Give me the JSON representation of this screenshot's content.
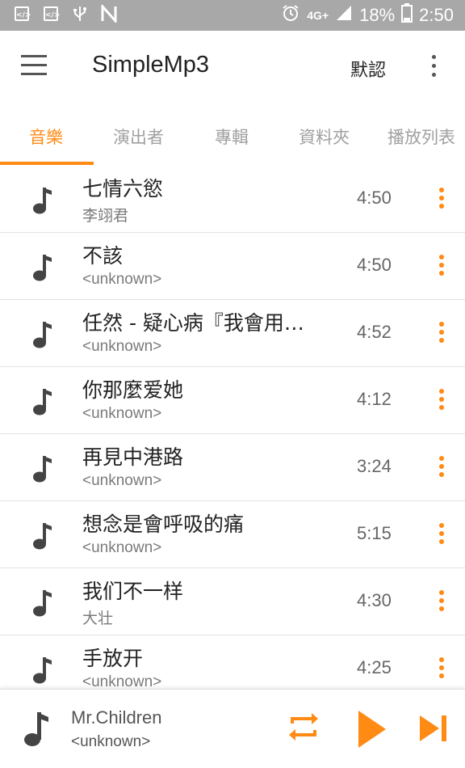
{
  "status_bar": {
    "battery": "18%",
    "time": "2:50",
    "network": "4G+"
  },
  "app_bar": {
    "title": "SimpleMp3",
    "default_label": "默認"
  },
  "tabs": [
    {
      "label": "音樂",
      "active": true
    },
    {
      "label": "演出者",
      "active": false
    },
    {
      "label": "專輯",
      "active": false
    },
    {
      "label": "資料夾",
      "active": false
    },
    {
      "label": "播放列表",
      "active": false
    }
  ],
  "songs": [
    {
      "title": "七情六慾",
      "artist": "李翊君",
      "duration": "4:50"
    },
    {
      "title": "不該",
      "artist": "<unknown>",
      "duration": "4:50"
    },
    {
      "title": "任然 - 疑心病『我會用…",
      "artist": "<unknown>",
      "duration": "4:52"
    },
    {
      "title": "你那麼爱她",
      "artist": "<unknown>",
      "duration": "4:12"
    },
    {
      "title": "再見中港路",
      "artist": "<unknown>",
      "duration": "3:24"
    },
    {
      "title": "想念是會呼吸的痛",
      "artist": "<unknown>",
      "duration": "5:15"
    },
    {
      "title": "我们不一样",
      "artist": "大壮",
      "duration": "4:30"
    },
    {
      "title": "手放开",
      "artist": "<unknown>",
      "duration": "4:25"
    }
  ],
  "now_playing": {
    "title": "Mr.Children",
    "artist": "<unknown>"
  },
  "colors": {
    "accent": "#ff8a14",
    "status_bar": "#a8a8a8"
  },
  "icons": [
    "menu-icon",
    "overflow-icon",
    "music-note-icon",
    "more-vert-icon",
    "repeat-icon",
    "play-icon",
    "skip-next-icon"
  ]
}
